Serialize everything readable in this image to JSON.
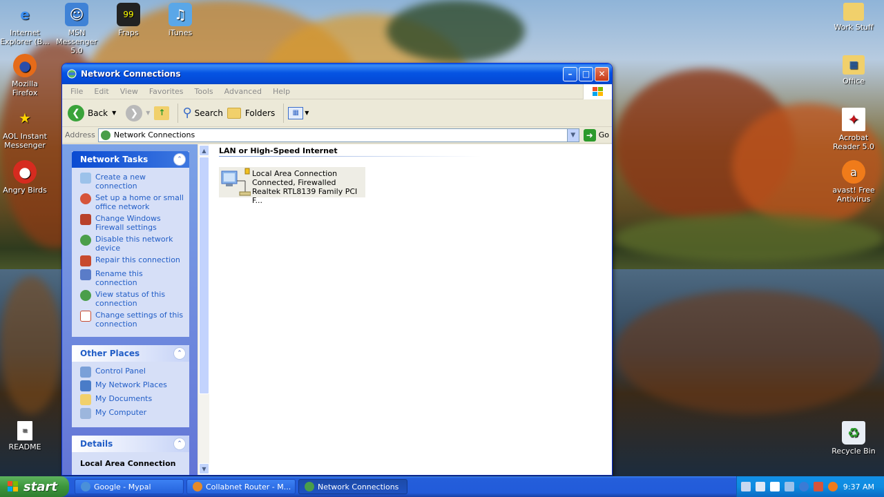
{
  "desktop": {
    "icons_left": [
      {
        "label": "Internet Explorer (B...",
        "icon": "internet-explorer-icon"
      },
      {
        "label": "MSN Messenger 5.0",
        "icon": "msn-messenger-icon"
      },
      {
        "label": "Fraps",
        "icon": "fraps-icon"
      },
      {
        "label": "iTunes",
        "icon": "itunes-icon"
      },
      {
        "label": "Mozilla Firefox",
        "icon": "firefox-icon"
      },
      {
        "label": "AOL Instant Messenger",
        "icon": "aol-messenger-icon"
      },
      {
        "label": "Angry Birds",
        "icon": "angry-birds-icon"
      },
      {
        "label": "README",
        "icon": "readme-document-icon"
      }
    ],
    "icons_right": [
      {
        "label": "Work Stuff",
        "icon": "folder-icon"
      },
      {
        "label": "Office",
        "icon": "office-folder-icon"
      },
      {
        "label": "Acrobat Reader 5.0",
        "icon": "acrobat-icon"
      },
      {
        "label": "avast! Free Antivirus",
        "icon": "avast-icon"
      },
      {
        "label": "Recycle Bin",
        "icon": "recycle-bin-icon"
      }
    ]
  },
  "window": {
    "title": "Network Connections",
    "menu": [
      "File",
      "Edit",
      "View",
      "Favorites",
      "Tools",
      "Advanced",
      "Help"
    ],
    "toolbar": {
      "back_label": "Back",
      "search_label": "Search",
      "folders_label": "Folders"
    },
    "address": {
      "label": "Address",
      "value": "Network Connections",
      "go_label": "Go"
    },
    "network_tasks": {
      "title": "Network Tasks",
      "items": [
        "Create a new connection",
        "Set up a home or small office network",
        "Change Windows Firewall settings",
        "Disable this network device",
        "Repair this connection",
        "Rename this connection",
        "View status of this connection",
        "Change settings of this connection"
      ]
    },
    "other_places": {
      "title": "Other Places",
      "items": [
        "Control Panel",
        "My Network Places",
        "My Documents",
        "My Computer"
      ]
    },
    "details": {
      "title": "Details",
      "selected": "Local Area Connection"
    },
    "content": {
      "group_title": "LAN or High-Speed Internet",
      "connection": {
        "name": "Local Area Connection",
        "status": "Connected, Firewalled",
        "device": "Realtek RTL8139 Family PCI F..."
      }
    }
  },
  "taskbar": {
    "start_label": "start",
    "buttons": [
      {
        "label": "Google - Mypal",
        "active": false
      },
      {
        "label": "Collabnet Router - M...",
        "active": false
      },
      {
        "label": "Network Connections",
        "active": true
      }
    ],
    "clock": "9:37 AM"
  }
}
